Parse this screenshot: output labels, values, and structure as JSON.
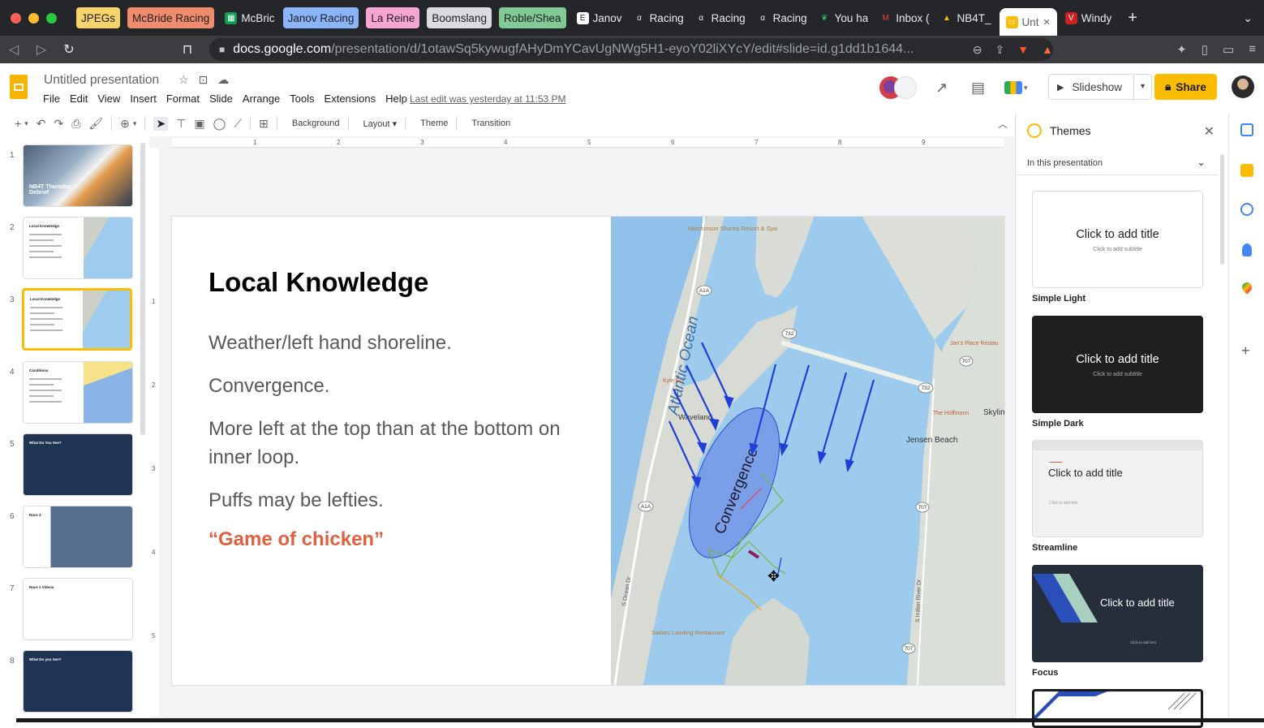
{
  "browser": {
    "tabs": [
      {
        "label": "JPEGs",
        "color": "#f6d36b",
        "group": true
      },
      {
        "label": "McBride Racing",
        "color": "#f08c6e",
        "group": true
      },
      {
        "label": "McBric",
        "icon": "sheets",
        "group": false
      },
      {
        "label": "Janov Racing",
        "color": "#8ab4f8",
        "group": true
      },
      {
        "label": "La Reine",
        "color": "#f8a5d2",
        "group": true
      },
      {
        "label": "Boomslang",
        "color": "#dadce0",
        "group": true
      },
      {
        "label": "Roble/Shea",
        "color": "#81c995",
        "group": true
      },
      {
        "label": "Janov",
        "icon": "e",
        "group": false
      },
      {
        "label": "Racing",
        "icon": "alpha",
        "group": false
      },
      {
        "label": "Racing",
        "icon": "alpha",
        "group": false
      },
      {
        "label": "Racing",
        "icon": "alpha",
        "group": false
      },
      {
        "label": "You ha",
        "icon": "evernote",
        "group": false
      },
      {
        "label": "Inbox (",
        "icon": "gmail",
        "group": false
      },
      {
        "label": "NB4T_",
        "icon": "drive",
        "group": false
      },
      {
        "label": "Unt",
        "icon": "slides",
        "group": false,
        "active": true
      },
      {
        "label": "Windy",
        "icon": "windy",
        "group": false
      }
    ],
    "url_host": "docs.google.com",
    "url_path": "/presentation/d/1otawSq5kywugfAHyDmYCavUgNWg5H1-eyoY02liXYcY/edit#slide=id.g1dd1b1644..."
  },
  "app": {
    "title": "Untitled presentation",
    "menu": [
      "File",
      "Edit",
      "View",
      "Insert",
      "Format",
      "Slide",
      "Arrange",
      "Tools",
      "Extensions",
      "Help"
    ],
    "last_edit": "Last edit was yesterday at 11:53 PM",
    "slideshow_label": "Slideshow",
    "share_label": "Share"
  },
  "toolbar": {
    "background": "Background",
    "layout": "Layout",
    "theme": "Theme",
    "transition": "Transition"
  },
  "ruler": {
    "h_ticks": [
      "1",
      "2",
      "3",
      "4",
      "5",
      "6",
      "7",
      "8",
      "9"
    ],
    "v_ticks": [
      "1",
      "2",
      "3",
      "4",
      "5"
    ]
  },
  "filmstrip": [
    {
      "num": "1",
      "title": "NB4T Thursday Debrief",
      "kind": "photo"
    },
    {
      "num": "2",
      "title": "Local Knowledge",
      "kind": "map"
    },
    {
      "num": "3",
      "title": "Local Knowledge",
      "kind": "map",
      "selected": true
    },
    {
      "num": "4",
      "title": "Conditions",
      "kind": "chart"
    },
    {
      "num": "5",
      "title": "What Do You See?",
      "kind": "dark"
    },
    {
      "num": "6",
      "title": "Race 1",
      "kind": "video"
    },
    {
      "num": "7",
      "title": "Race 1 Videos",
      "kind": "blank"
    },
    {
      "num": "8",
      "title": "What Do you See?",
      "kind": "dark"
    }
  ],
  "slide": {
    "title": "Local Knowledge",
    "bullets": [
      "Weather/left hand shoreline.",
      "Convergence.",
      "More left at the top than at the bottom on inner loop.",
      "Puffs may be lefties."
    ],
    "highlight": "“Game of chicken”",
    "highlight_color": "#e0603f",
    "map": {
      "ocean_label": "Atlantic Ocean",
      "convergence_label": "Convergence",
      "places": [
        "Hutchinson Shores Resort & Spa",
        "Waveland",
        "Jensen Beach",
        "Skylin",
        "Sailors Landing Restaurant",
        "Jan's Place Restau",
        "The Hoffmann",
        "Kyle Go"
      ],
      "roads": [
        "A1A",
        "732",
        "707",
        "A1A",
        "707",
        "732",
        "707"
      ],
      "street_labels": [
        "S Ocean Dr",
        "S Indian River Dr"
      ]
    }
  },
  "themes_panel": {
    "title": "Themes",
    "section": "In this presentation",
    "themes": [
      {
        "name": "Simple Light",
        "placeholder_title": "Click to add title",
        "placeholder_sub": "Click to add subtitle"
      },
      {
        "name": "Simple Dark",
        "placeholder_title": "Click to add title",
        "placeholder_sub": "Click to add subtitle"
      },
      {
        "name": "Streamline",
        "placeholder_title": "Click to add title",
        "placeholder_sub": "Click to add text"
      },
      {
        "name": "Focus",
        "placeholder_title": "Click to add title",
        "placeholder_sub": "Click to add text"
      }
    ]
  }
}
